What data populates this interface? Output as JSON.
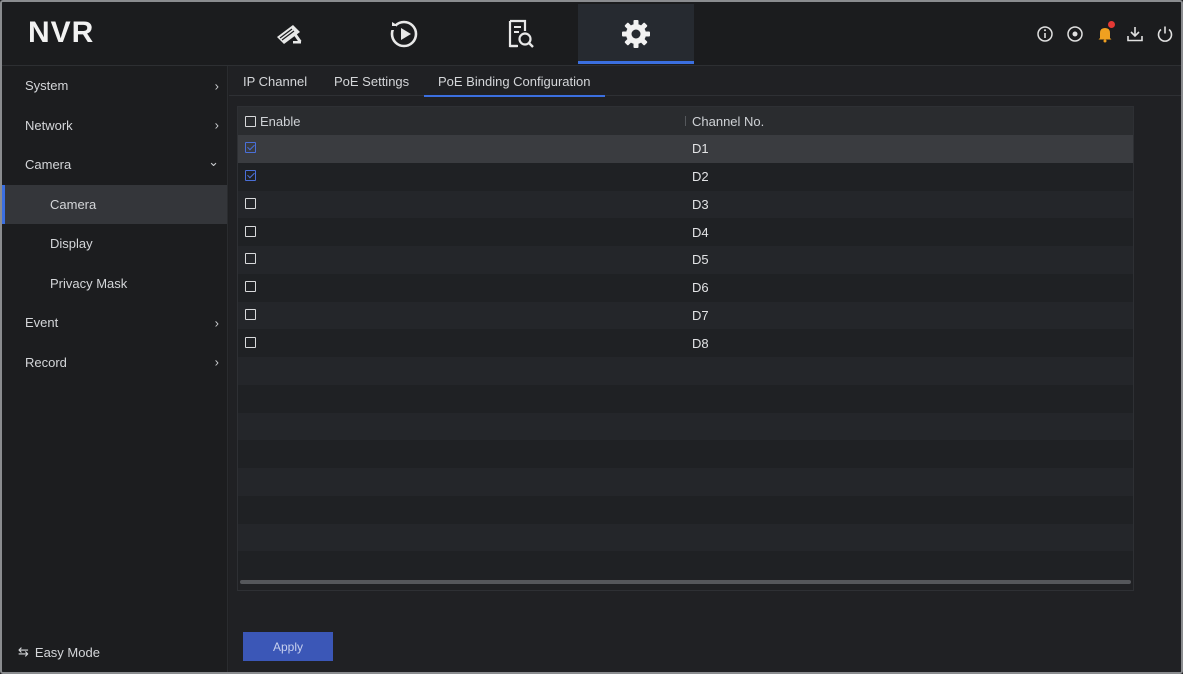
{
  "header": {
    "logo": "NVR",
    "nav_tabs": [
      {
        "icon": "camera-icon",
        "active": false
      },
      {
        "icon": "playback-icon",
        "active": false
      },
      {
        "icon": "file-search-icon",
        "active": false
      },
      {
        "icon": "gear-icon",
        "active": true
      }
    ],
    "right_icons": [
      "info-icon",
      "target-icon",
      "bell-icon",
      "download-icon",
      "power-icon"
    ],
    "accent_color": "#3b6fe0"
  },
  "sidebar": {
    "items": [
      {
        "label": "System",
        "chevron": "›"
      },
      {
        "label": "Network",
        "chevron": "›"
      },
      {
        "label": "Camera",
        "chevron": "⌄"
      },
      {
        "label": "Camera",
        "sub": true,
        "active": true
      },
      {
        "label": "Display",
        "sub": true
      },
      {
        "label": "Privacy Mask",
        "sub": true
      },
      {
        "label": "Event",
        "chevron": "›"
      },
      {
        "label": "Record",
        "chevron": "›"
      }
    ],
    "easy_mode": "Easy Mode",
    "easy_mode_icon": "⇆"
  },
  "tabs": [
    {
      "label": "IP Channel"
    },
    {
      "label": "PoE Settings"
    },
    {
      "label": "PoE Binding Configuration",
      "active": true
    }
  ],
  "table": {
    "headers": {
      "enable": "Enable",
      "channel": "Channel No."
    },
    "rows": [
      {
        "enabled": true,
        "channel": "D1"
      },
      {
        "enabled": true,
        "channel": "D2"
      },
      {
        "enabled": false,
        "channel": "D3"
      },
      {
        "enabled": false,
        "channel": "D4"
      },
      {
        "enabled": false,
        "channel": "D5"
      },
      {
        "enabled": false,
        "channel": "D6"
      },
      {
        "enabled": false,
        "channel": "D7"
      },
      {
        "enabled": false,
        "channel": "D8"
      }
    ]
  },
  "apply_label": "Apply"
}
